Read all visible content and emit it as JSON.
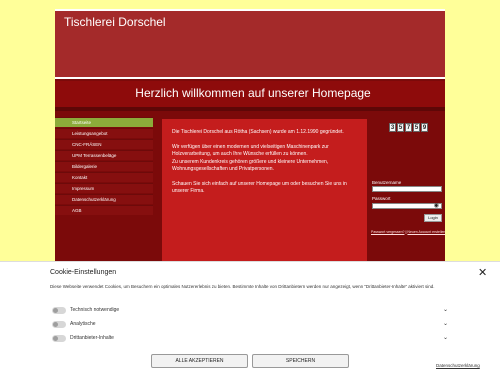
{
  "site": {
    "title": "Tischlerei Dorschel",
    "welcome": "Herzlich willkommen auf unserer Homepage"
  },
  "nav": {
    "items": [
      {
        "label": "Startseite",
        "active": true
      },
      {
        "label": "Leistungsangebot",
        "active": false
      },
      {
        "label": "CNC-FRÄSEN",
        "active": false
      },
      {
        "label": "UPM Terrassenbeläge",
        "active": false
      },
      {
        "label": "Bildergalerie",
        "active": false
      },
      {
        "label": "Kontakt",
        "active": false
      },
      {
        "label": "Impressum",
        "active": false
      },
      {
        "label": "Datenschutzerklärung",
        "active": false
      },
      {
        "label": "AGB",
        "active": false
      }
    ]
  },
  "content": {
    "p1": "Die Tischlerei Dorschel aus Rötha (Sachsen) wurde am 1.12.1990 gegründet.",
    "p2": "Wir verfügen über einen modernen und vielseitigen Maschinenpark zur Holzverarbeitung, um auch Ihre Wünsche erfüllen zu können.",
    "p3": "Zu unserem Kundenkreis gehören größere und kleinere Unternehmen, Wohnungsgesellschaften und Privatpersonen.",
    "p4": "Schauen Sie sich einfach auf unserer Homepage um oder besuchen Sie uns in unserer Firma."
  },
  "counter": {
    "digits": [
      "3",
      "5",
      "7",
      "5",
      "9"
    ]
  },
  "login": {
    "user_label": "Benutzername",
    "password_label": "Passwort",
    "button": "Login",
    "forgot": "Passwort vergessen?",
    "sep": "|",
    "new": "Neuen Account erstellen"
  },
  "cookie": {
    "title": "Cookie-Einstellungen",
    "description": "Diese Webseite verwendet Cookies, um Besuchern ein optimales Nutzererlebnis zu bieten. Bestimmte Inhalte von Drittanbietern werden nur angezeigt, wenn \"Drittanbieter-Inhalte\" aktiviert sind.",
    "rows": [
      {
        "label": "Technisch notwendige"
      },
      {
        "label": "Analytische"
      },
      {
        "label": "Drittanbieter-Inhalte"
      }
    ],
    "accept_all": "ALLE AKZEPTIEREN",
    "save": "SPEICHERN",
    "privacy": "Datenschutzerklärung",
    "close": "✕",
    "chevron": "⌄"
  },
  "colors": {
    "page_bg": "#ffff99",
    "site_bg": "#7b0a0a",
    "header_bg": "#a42a2a",
    "content_bg": "#c41d1d",
    "active_nav": "#8cab3a"
  }
}
